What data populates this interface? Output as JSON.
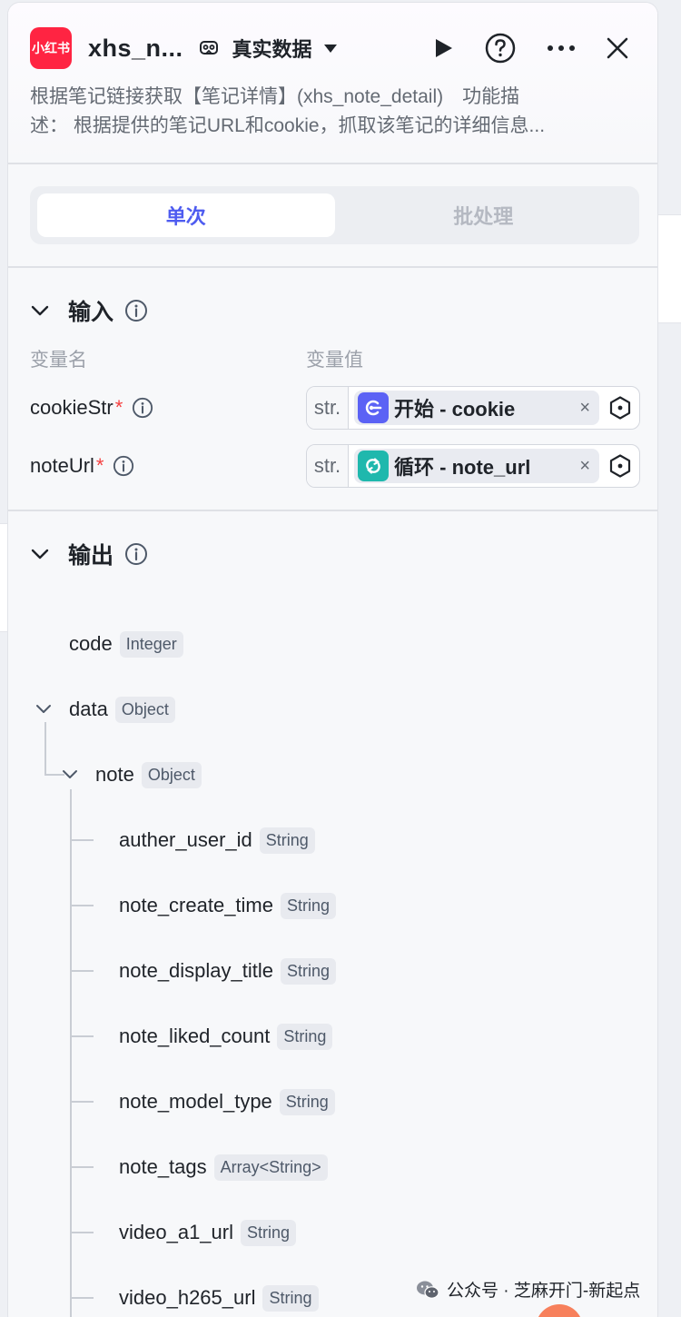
{
  "header": {
    "logo_text": "小红书",
    "title": "xhs_n...",
    "mode": "真实数据",
    "description_line1": "根据笔记链接获取【笔记详情】(xhs_note_detail)　功能描",
    "description_line2": "述：  根据提供的笔记URL和cookie，抓取该笔记的详细信息..."
  },
  "tabs": {
    "single": "单次",
    "batch": "批处理"
  },
  "input": {
    "title": "输入",
    "col_name": "变量名",
    "col_value": "变量值",
    "rows": [
      {
        "name": "cookieStr",
        "required": "*",
        "type": "str.",
        "source": "开始",
        "sep": " - ",
        "field": "cookie",
        "clear": "×"
      },
      {
        "name": "noteUrl",
        "required": "*",
        "type": "str.",
        "source": "循环",
        "sep": " - ",
        "field": "note_url",
        "clear": "×"
      }
    ]
  },
  "output": {
    "title": "输出",
    "fields": [
      {
        "name": "code",
        "type": "Integer"
      },
      {
        "name": "data",
        "type": "Object"
      },
      {
        "name": "note",
        "type": "Object"
      },
      {
        "name": "auther_user_id",
        "type": "String"
      },
      {
        "name": "note_create_time",
        "type": "String"
      },
      {
        "name": "note_display_title",
        "type": "String"
      },
      {
        "name": "note_liked_count",
        "type": "String"
      },
      {
        "name": "note_model_type",
        "type": "String"
      },
      {
        "name": "note_tags",
        "type": "Array<String>"
      },
      {
        "name": "video_a1_url",
        "type": "String"
      },
      {
        "name": "video_h265_url",
        "type": "String"
      }
    ]
  },
  "watermark": "公众号 · 芝麻开门-新起点",
  "colors": {
    "accent": "#4e5cf0",
    "brand": "#ff2442",
    "start_node": "#5b62f5",
    "loop_node": "#1fb8ad"
  }
}
